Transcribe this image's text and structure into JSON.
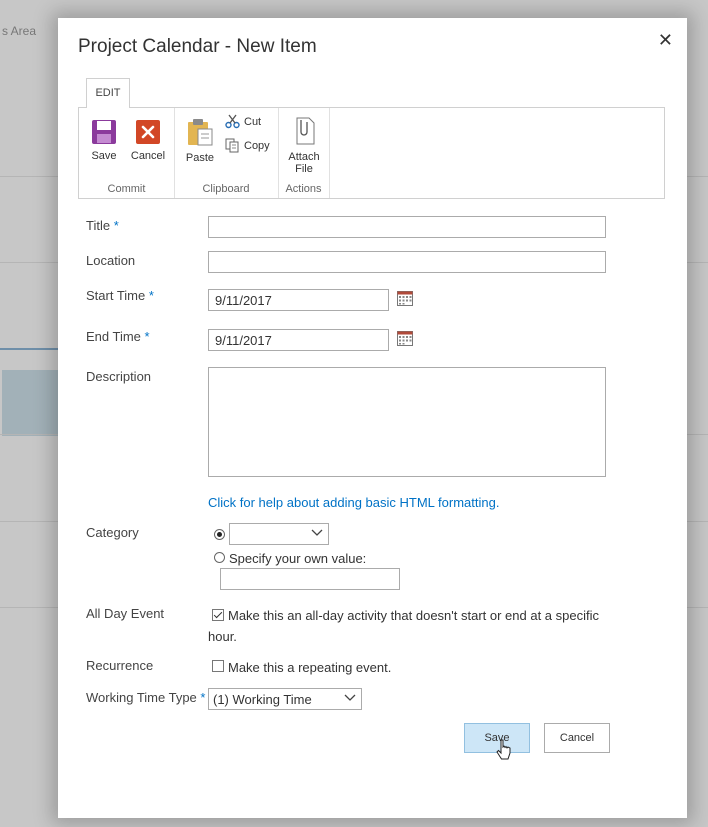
{
  "background": {
    "area_text": "s Area"
  },
  "dialog": {
    "title": "Project Calendar - New Item",
    "close_symbol": "✕"
  },
  "ribbon": {
    "tab": "EDIT",
    "groups": {
      "commit": {
        "label": "Commit",
        "save": "Save",
        "cancel": "Cancel"
      },
      "clipboard": {
        "label": "Clipboard",
        "paste": "Paste",
        "cut": "Cut",
        "copy": "Copy"
      },
      "actions": {
        "label": "Actions",
        "attach_line1": "Attach",
        "attach_line2": "File"
      }
    }
  },
  "form": {
    "required_mark": "*",
    "title": {
      "label": "Title",
      "value": ""
    },
    "location": {
      "label": "Location",
      "value": ""
    },
    "start_time": {
      "label": "Start Time",
      "value": "9/11/2017"
    },
    "end_time": {
      "label": "End Time",
      "value": "9/11/2017"
    },
    "description": {
      "label": "Description",
      "value": ""
    },
    "help_link": "Click for help about adding basic HTML formatting.",
    "category": {
      "label": "Category",
      "selected": "",
      "own_value_label": "Specify your own value:",
      "own_value": ""
    },
    "all_day": {
      "label": "All Day Event",
      "text_line1": "Make this an all-day activity that doesn't start or end at a specific",
      "text_line2": "hour.",
      "checked": true
    },
    "recurrence": {
      "label": "Recurrence",
      "text": "Make this a repeating event.",
      "checked": false
    },
    "working_time": {
      "label": "Working Time Type",
      "selected": "(1) Working Time"
    }
  },
  "buttons": {
    "save": "Save",
    "cancel": "Cancel"
  },
  "colors": {
    "accent": "#0072c6",
    "save_icon": "#8b3a9c",
    "cancel_icon": "#d24726"
  }
}
